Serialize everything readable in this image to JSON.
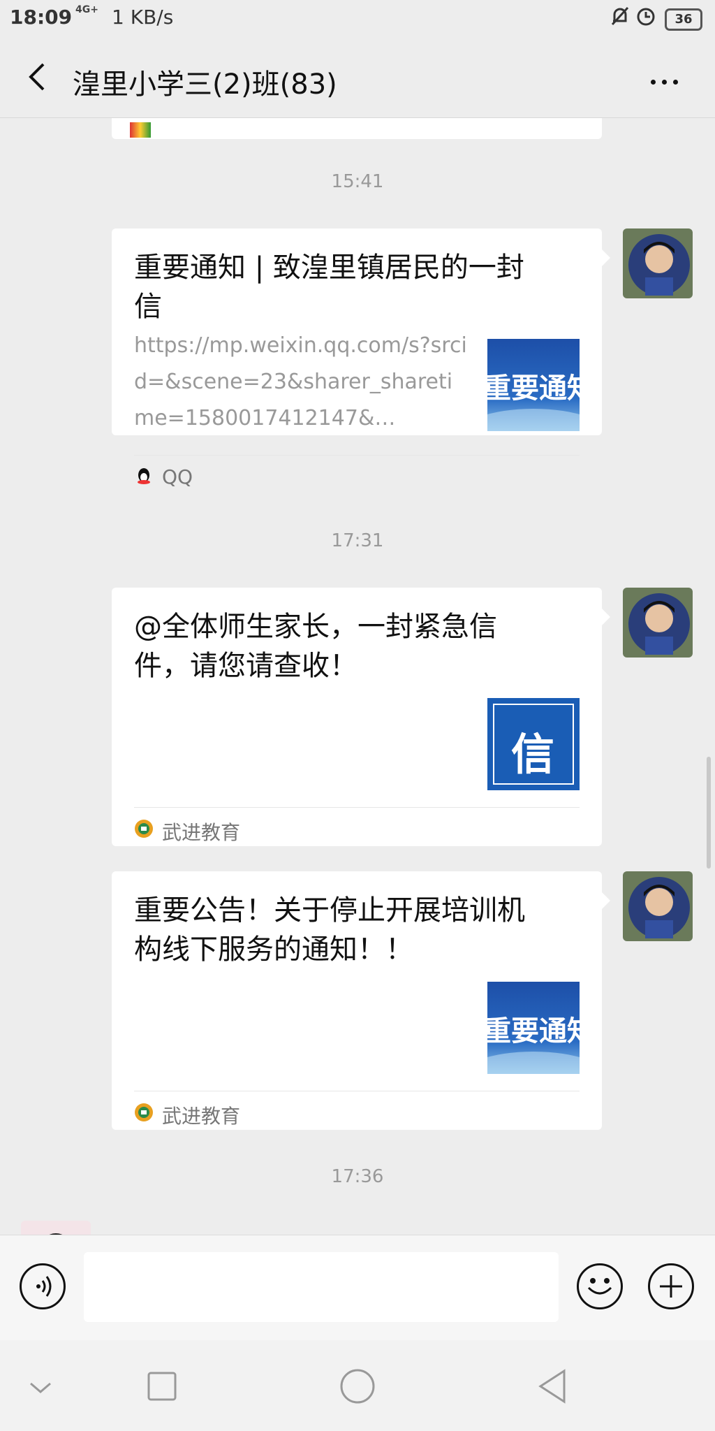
{
  "status_bar": {
    "time": "18:09",
    "network": "4G+",
    "speed": "1 KB/s",
    "battery": "36"
  },
  "header": {
    "title": "湟里小学三(2)班(83)"
  },
  "messages": [
    {
      "time": "15:41",
      "title": "重要通知 | 致湟里镇居民的一封信",
      "desc": "https://mp.weixin.qq.com/s?srcid=&scene=23&sharer_sharetime=1580017412147&…",
      "thumb_text": "重要通知",
      "source": "QQ"
    },
    {
      "time": "17:31",
      "title": "@全体师生家长，一封紧急信件，请您请查收！",
      "thumb_text": "信",
      "source": "武进教育"
    },
    {
      "title": "重要公告！关于停止开展培训机构线下服务的通知！！",
      "thumb_text": "重要通知",
      "source": "武进教育"
    }
  ],
  "last_time": "17:36",
  "input": {
    "value": ""
  },
  "colors": {
    "background": "#ededed",
    "card": "#ffffff",
    "thumb_blue": "#1a5db5"
  }
}
